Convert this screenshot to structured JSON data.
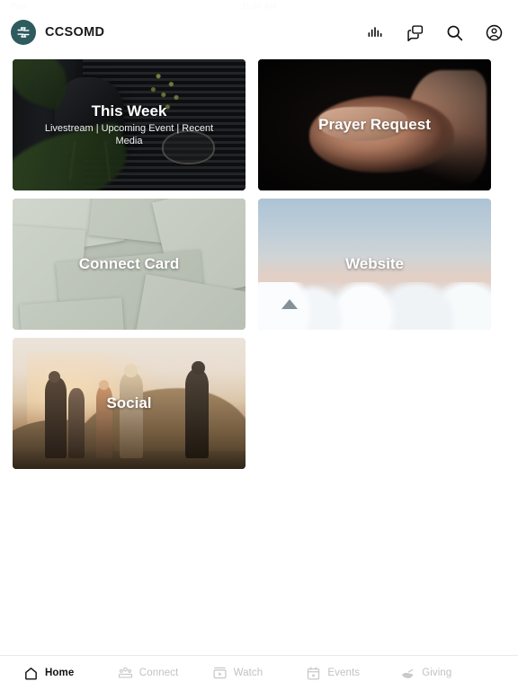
{
  "status_bar": {
    "device": "iPad",
    "time": "11:39 AM"
  },
  "header": {
    "brand_name": "CCSOMD",
    "logo_icon": "church-circle-logo",
    "actions": [
      {
        "name": "equalizer-icon",
        "label": "Activity"
      },
      {
        "name": "chat-bubbles-icon",
        "label": "Messages"
      },
      {
        "name": "search-icon",
        "label": "Search"
      },
      {
        "name": "account-circle-icon",
        "label": "Account"
      }
    ]
  },
  "tiles": [
    {
      "id": "this-week",
      "title": "This Week",
      "subtitle": "Livestream | Upcoming Event | Recent Media",
      "image": "dark-room-chair-blinds-plant"
    },
    {
      "id": "prayer-request",
      "title": "Prayer Request",
      "subtitle": "",
      "image": "open-cupped-hands-dark"
    },
    {
      "id": "connect-card",
      "title": "Connect Card",
      "subtitle": "",
      "image": "sage-green-paper-sheets"
    },
    {
      "id": "website",
      "title": "Website",
      "subtitle": "",
      "image": "sky-above-clouds"
    },
    {
      "id": "social",
      "title": "Social",
      "subtitle": "",
      "image": "friends-on-hill-at-sunset"
    }
  ],
  "tabbar": {
    "items": [
      {
        "label": "Home",
        "icon": "home-icon",
        "active": true
      },
      {
        "label": "Connect",
        "icon": "people-icon",
        "active": false
      },
      {
        "label": "Watch",
        "icon": "video-icon",
        "active": false
      },
      {
        "label": "Events",
        "icon": "calendar-icon",
        "active": false
      },
      {
        "label": "Giving",
        "icon": "giving-hand-icon",
        "active": false
      }
    ]
  },
  "colors": {
    "brand_teal": "#2e5b5e",
    "active_tab": "#111111",
    "inactive_tab": "#c2c2c2",
    "page_background": "#ffffff"
  }
}
